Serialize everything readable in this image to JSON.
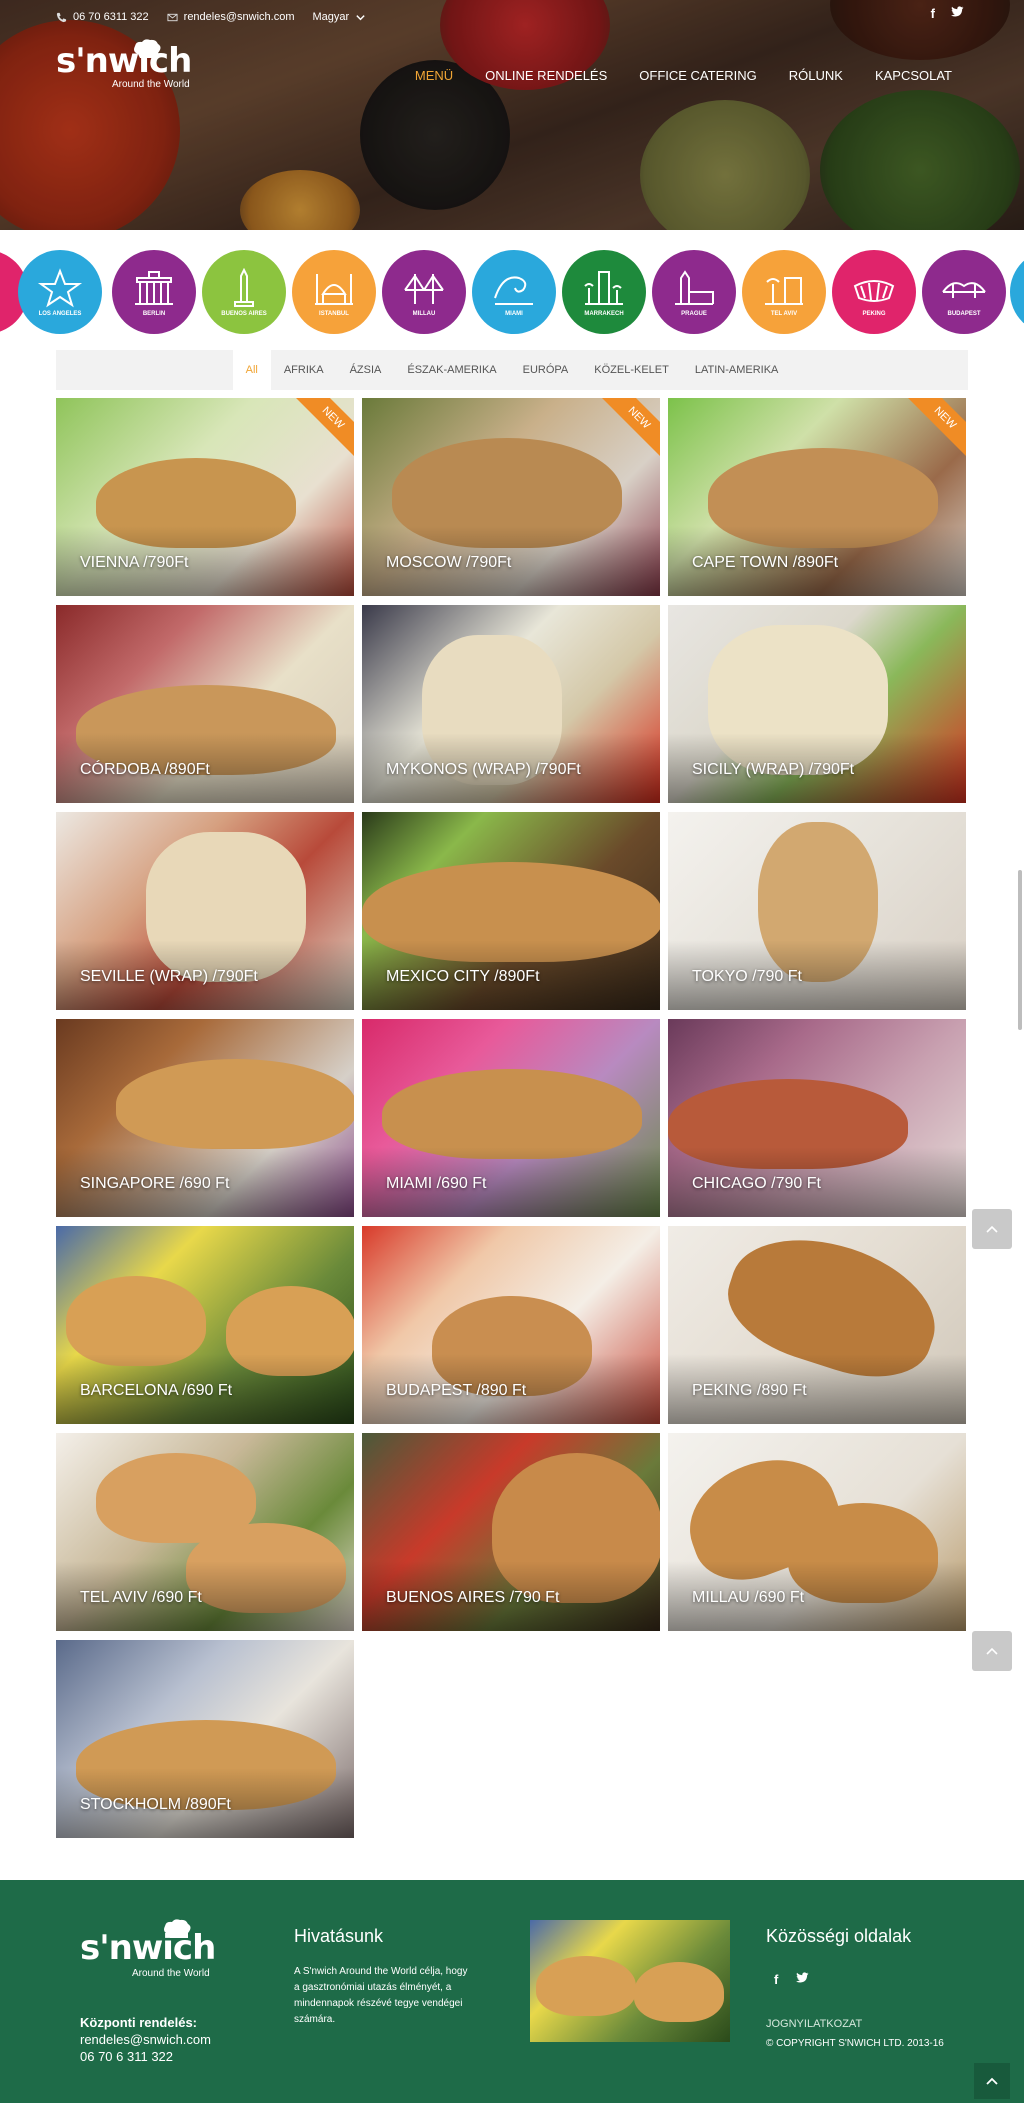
{
  "topbar": {
    "phone": "06 70 6311 322",
    "email": "rendeles@snwich.com",
    "language": "Magyar"
  },
  "brand": {
    "name": "s'nwich",
    "tagline": "Around the World"
  },
  "nav": [
    {
      "label": "MENÜ",
      "active": true
    },
    {
      "label": "ONLINE RENDELÉS",
      "active": false
    },
    {
      "label": "OFFICE CATERING",
      "active": false
    },
    {
      "label": "RÓLUNK",
      "active": false
    },
    {
      "label": "KAPCSOLAT",
      "active": false
    }
  ],
  "cities": [
    {
      "label": "",
      "color": "#e0246b"
    },
    {
      "label": "LOS ANGELES",
      "color": "#2aa8dc"
    },
    {
      "label": "BERLIN",
      "color": "#8e2a8d"
    },
    {
      "label": "BUENOS AIRES",
      "color": "#8cc43f"
    },
    {
      "label": "ISTANBUL",
      "color": "#f6a23a"
    },
    {
      "label": "MILLAU",
      "color": "#8e2a8d"
    },
    {
      "label": "MIAMI",
      "color": "#2aa8dc"
    },
    {
      "label": "MARRAKECH",
      "color": "#1e8a3c"
    },
    {
      "label": "PRAGUE",
      "color": "#8e2a8d"
    },
    {
      "label": "TEL AVIV",
      "color": "#f6a23a"
    },
    {
      "label": "PEKING",
      "color": "#e0246b"
    },
    {
      "label": "BUDAPEST",
      "color": "#8e2a8d"
    },
    {
      "label": "",
      "color": "#2aa8dc"
    }
  ],
  "filters": [
    {
      "label": "All",
      "active": true
    },
    {
      "label": "AFRIKA",
      "active": false
    },
    {
      "label": "ÁZSIA",
      "active": false
    },
    {
      "label": "ÉSZAK-AMERIKA",
      "active": false
    },
    {
      "label": "EURÓPA",
      "active": false
    },
    {
      "label": "KÖZEL-KELET",
      "active": false
    },
    {
      "label": "LATIN-AMERIKA",
      "active": false
    }
  ],
  "products": [
    {
      "title": "VIENNA /790Ft",
      "badge": "NEW"
    },
    {
      "title": "MOSCOW /790Ft",
      "badge": "NEW"
    },
    {
      "title": "CAPE TOWN /890Ft",
      "badge": "NEW"
    },
    {
      "title": "CÓRDOBA /890Ft",
      "badge": ""
    },
    {
      "title": "MYKONOS (WRAP) /790Ft",
      "badge": ""
    },
    {
      "title": "SICILY (WRAP) /790Ft",
      "badge": ""
    },
    {
      "title": "SEVILLE (WRAP) /790Ft",
      "badge": ""
    },
    {
      "title": "MEXICO CITY /890Ft",
      "badge": ""
    },
    {
      "title": "TOKYO /790 Ft",
      "badge": ""
    },
    {
      "title": "SINGAPORE /690 Ft",
      "badge": ""
    },
    {
      "title": "MIAMI /690 Ft",
      "badge": ""
    },
    {
      "title": "CHICAGO /790 Ft",
      "badge": ""
    },
    {
      "title": "BARCELONA /690 Ft",
      "badge": ""
    },
    {
      "title": "BUDAPEST /890 Ft",
      "badge": ""
    },
    {
      "title": "PEKING /890 Ft",
      "badge": ""
    },
    {
      "title": "TEL AVIV /690 Ft",
      "badge": ""
    },
    {
      "title": "BUENOS AIRES /790 Ft",
      "badge": ""
    },
    {
      "title": "MILLAU /690 Ft",
      "badge": ""
    },
    {
      "title": "STOCKHOLM /890Ft",
      "badge": ""
    }
  ],
  "footer": {
    "contact_label": "Központi rendelés:",
    "contact_email": "rendeles@snwich.com",
    "contact_phone": "06 70 6 311 322",
    "mission_title": "Hivatásunk",
    "mission_text": "A S'nwich Around the World célja, hogy a gasztronómiai utazás élményét, a mindennapok részévé tegye vendégei számára.",
    "social_title": "Közösségi oldalak",
    "legal": "JOGNYILATKOZAT",
    "copyright": "© COPYRIGHT S'NWICH LTD. 2013-16"
  },
  "colors": {
    "accent": "#f0a535",
    "footer_bg": "#1e6b48",
    "ribbon": "#f08c25"
  },
  "icons": [
    "phone-icon",
    "envelope-icon",
    "chevron-down-icon",
    "facebook-icon",
    "twitter-icon",
    "chef-hat-icon",
    "chevron-up-icon"
  ]
}
